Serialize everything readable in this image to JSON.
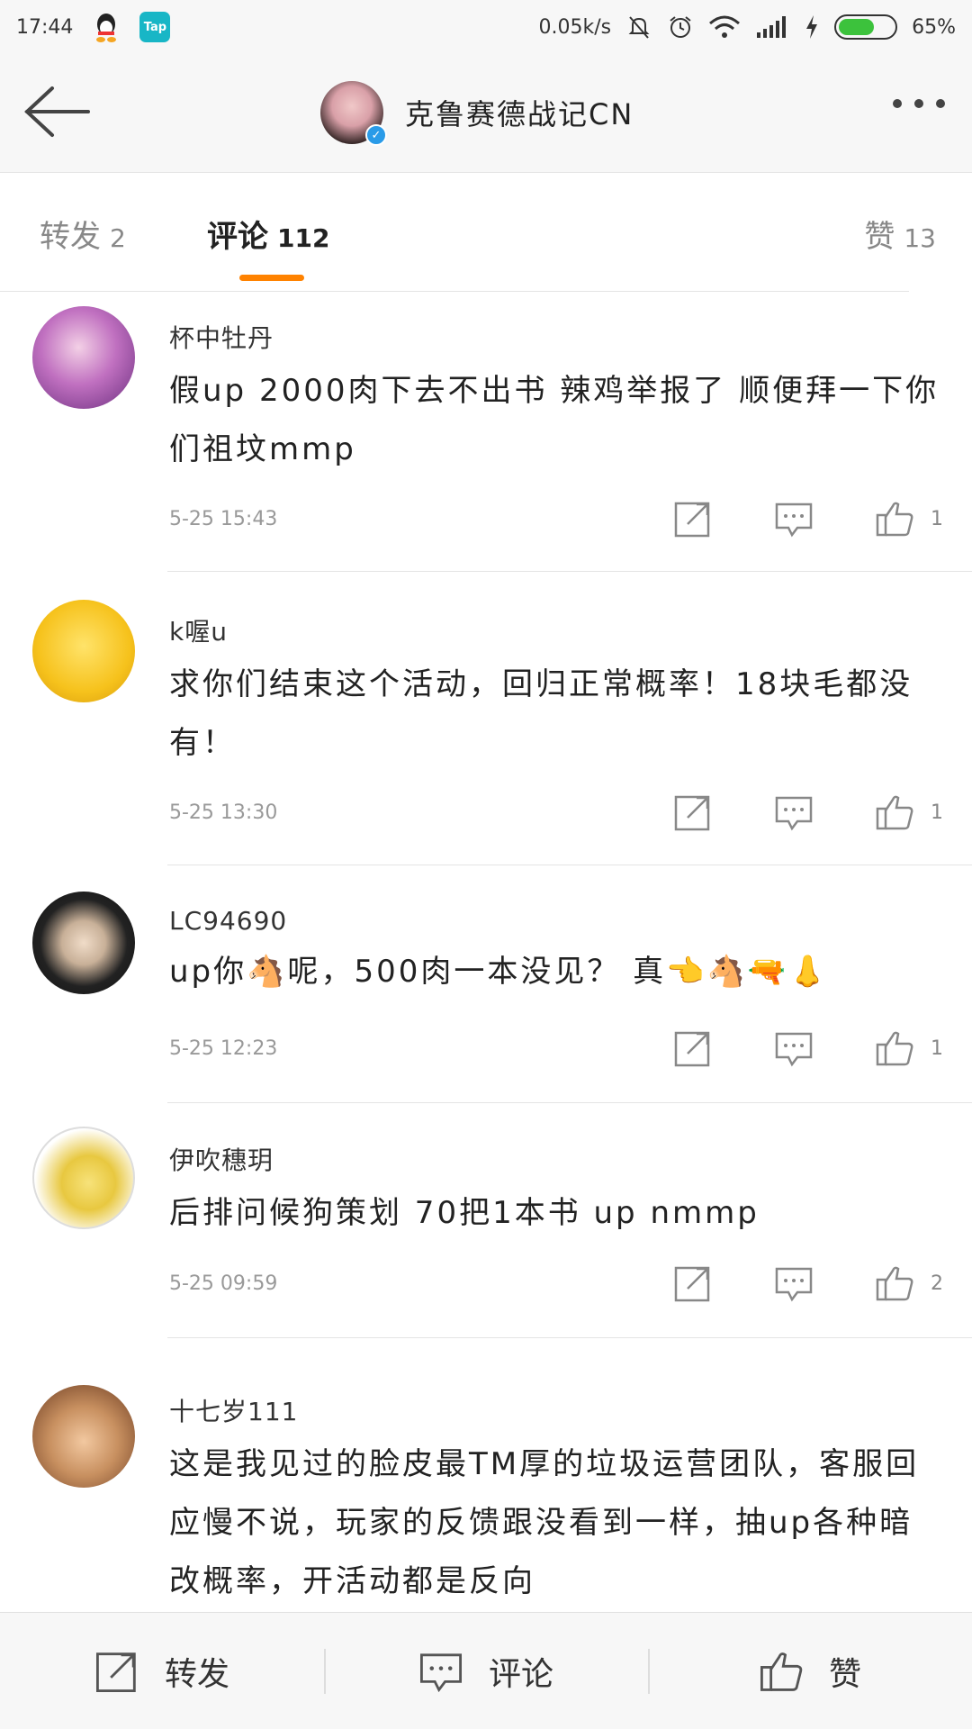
{
  "status": {
    "time": "17:44",
    "net_speed": "0.05k/s",
    "battery_level": 0.65,
    "battery_text": "65%",
    "tap_label": "Tap"
  },
  "header": {
    "title": "克鲁赛德战记CN"
  },
  "tabs": [
    {
      "label": "转发",
      "count": "2"
    },
    {
      "label": "评论",
      "count": "112"
    },
    {
      "label": "赞",
      "count": "13"
    }
  ],
  "comments": [
    {
      "username": "杯中牡丹",
      "text": "假up  2000肉下去不出书  辣鸡举报了  顺便拜一下你们祖坟mmp",
      "time": "5-25 15:43",
      "likes": "1"
    },
    {
      "username": "k喔u",
      "text": "求你们结束这个活动，回归正常概率！18块毛都没有！",
      "time": "5-25 13:30",
      "likes": "1"
    },
    {
      "username": "LC94690",
      "text": "up你🐴呢，500肉一本没见？  真👈🐴🔫👃",
      "time": "5-25 12:23",
      "likes": "1"
    },
    {
      "username": "伊吹穗玥",
      "text": "后排问候狗策划   70把1本书  up nmmp",
      "time": "5-25 09:59",
      "likes": "2"
    },
    {
      "username": "十七岁111",
      "text": "这是我见过的脸皮最TM厚的垃圾运营团队，客服回应慢不说，玩家的反馈跟没看到一样，抽up各种暗改概率，开活动都是反向",
      "time": "",
      "likes": ""
    }
  ],
  "bottom_bar": {
    "repost_label": "转发",
    "comment_label": "评论",
    "like_label": "赞"
  },
  "icons": {
    "back": "arrow-left-icon",
    "more": "more-dots-icon",
    "repost": "share-icon",
    "comment": "comment-icon",
    "like": "thumbs-up-icon"
  },
  "colors": {
    "accent": "#ff8200",
    "verified": "#2a9be8"
  }
}
